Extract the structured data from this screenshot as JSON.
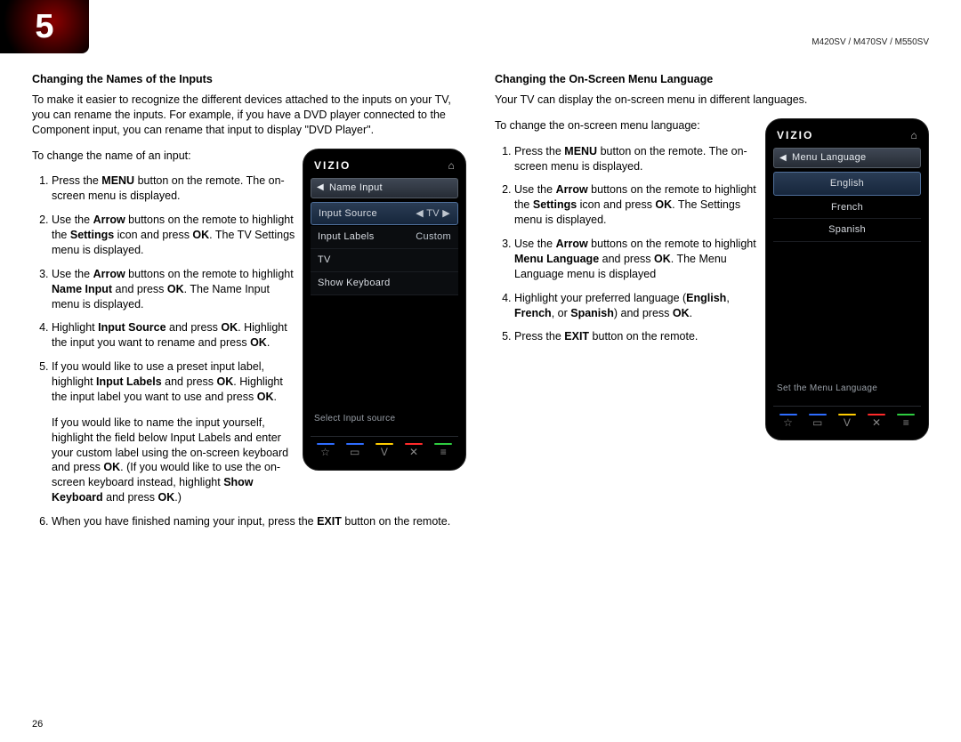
{
  "chapter": "5",
  "model_line": "M420SV / M470SV / M550SV",
  "page_number": "26",
  "left": {
    "title": "Changing the Names of the Inputs",
    "intro": "To make it easier to recognize the different devices attached to the inputs on your TV, you can rename the inputs. For example, if you have a DVD player connected to the Component input, you can rename that input to display \"DVD Player\".",
    "lead": "To change the name of an input:",
    "s1a": "Press the ",
    "s1b": "MENU",
    "s1c": " button on the remote. The on-screen menu is displayed.",
    "s2a": "Use the ",
    "s2b": "Arrow",
    "s2c": " buttons on the remote to highlight the ",
    "s2d": "Settings",
    "s2e": " icon and press ",
    "s2f": "OK",
    "s2g": ". The TV Settings menu is displayed.",
    "s3a": "Use the ",
    "s3b": "Arrow",
    "s3c": " buttons on the remote to highlight ",
    "s3d": "Name Input",
    "s3e": " and press ",
    "s3f": "OK",
    "s3g": ". The Name Input menu is displayed.",
    "s4a": "Highlight ",
    "s4b": "Input Source",
    "s4c": " and press ",
    "s4d": "OK",
    "s4e": ". Highlight the input you want to rename and press ",
    "s4f": "OK",
    "s4g": ".",
    "s5a": "If you would like to use a preset input label, highlight ",
    "s5b": "Input Labels",
    "s5c": " and press ",
    "s5d": "OK",
    "s5e": ". Highlight the input label you want to use and press ",
    "s5f": "OK",
    "s5g": ".",
    "note_a": "If you would like to name the input yourself, highlight the field below Input Labels and enter your custom label using the on-screen keyboard and press ",
    "note_b": "OK",
    "note_c": ". (If you would like to use the on-screen keyboard instead, highlight ",
    "note_d": "Show Keyboard",
    "note_e": " and press ",
    "note_f": "OK",
    "note_g": ".)",
    "s6a": "When you have finished naming your input, press the ",
    "s6b": "EXIT",
    "s6c": " button on the remote.",
    "osd": {
      "brand": "VIZIO",
      "breadcrumb": "Name Input",
      "row_input_source": "Input Source",
      "row_input_source_val": "TV",
      "row_input_labels": "Input Labels",
      "row_input_labels_val": "Custom",
      "row_tv": "TV",
      "row_show_kb": "Show Keyboard",
      "hint": "Select Input source"
    }
  },
  "right": {
    "title": "Changing the On-Screen Menu Language",
    "intro": "Your TV can display the on-screen menu in different languages.",
    "lead": "To change the on-screen menu language:",
    "s1a": "Press the ",
    "s1b": "MENU",
    "s1c": " button on the remote. The on-screen menu is displayed.",
    "s2a": "Use the ",
    "s2b": "Arrow",
    "s2c": " buttons on the remote to highlight the ",
    "s2d": "Settings",
    "s2e": " icon and press ",
    "s2f": "OK",
    "s2g": ". The Settings menu is displayed.",
    "s3a": "Use the ",
    "s3b": "Arrow",
    "s3c": " buttons on the remote to highlight ",
    "s3d": "Menu Language",
    "s3e": " and press ",
    "s3f": "OK",
    "s3g": ". The Menu Language menu is displayed",
    "s4a": "Highlight your preferred language (",
    "s4b": "English",
    "s4c": ", ",
    "s4d": "French",
    "s4e": ", or ",
    "s4f": "Spanish",
    "s4g": ") and press ",
    "s4h": "OK",
    "s4i": ".",
    "s5a": "Press the ",
    "s5b": "EXIT",
    "s5c": " button on the remote.",
    "osd": {
      "brand": "VIZIO",
      "breadcrumb": "Menu Language",
      "english": "English",
      "french": "French",
      "spanish": "Spanish",
      "hint": "Set the Menu Language"
    }
  },
  "icons": {
    "home": "⌂",
    "back": "◀",
    "tv_tri": "◀ TV ▶",
    "star": "☆",
    "square": "▭",
    "v": "V",
    "x": "✕",
    "menu": "≡"
  }
}
